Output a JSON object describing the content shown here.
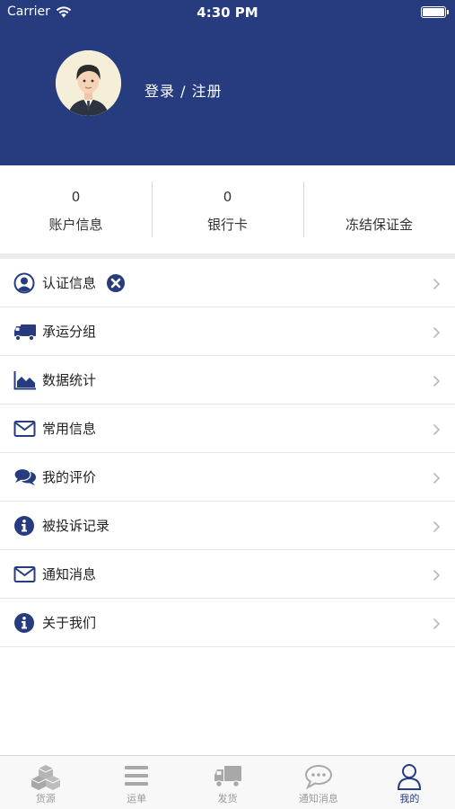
{
  "status_bar": {
    "carrier": "Carrier",
    "time": "4:30 PM"
  },
  "profile": {
    "login_text": "登录 / 注册"
  },
  "stats": [
    {
      "value": "0",
      "label": "账户信息"
    },
    {
      "value": "0",
      "label": "银行卡"
    },
    {
      "value": "",
      "label": "冻结保证金"
    }
  ],
  "menu": [
    {
      "label": "认证信息",
      "icon": "user-circle-icon"
    },
    {
      "label": "承运分组",
      "icon": "truck-icon"
    },
    {
      "label": "数据统计",
      "icon": "area-chart-icon"
    },
    {
      "label": "常用信息",
      "icon": "envelope-icon"
    },
    {
      "label": "我的评价",
      "icon": "comments-icon"
    },
    {
      "label": "被投诉记录",
      "icon": "info-circle-icon"
    },
    {
      "label": "通知消息",
      "icon": "envelope-icon"
    },
    {
      "label": "关于我们",
      "icon": "info-circle-icon"
    }
  ],
  "tabbar": [
    {
      "label": "货源",
      "icon": "cubes-icon",
      "active": false
    },
    {
      "label": "运单",
      "icon": "list-icon",
      "active": false
    },
    {
      "label": "发货",
      "icon": "truck-icon",
      "active": false
    },
    {
      "label": "通知消息",
      "icon": "comment-icon",
      "active": false
    },
    {
      "label": "我的",
      "icon": "user-icon",
      "active": true
    }
  ],
  "colors": {
    "brand": "#263c7f",
    "inactive_tab": "#9a9a9a",
    "background": "#ffffff"
  }
}
